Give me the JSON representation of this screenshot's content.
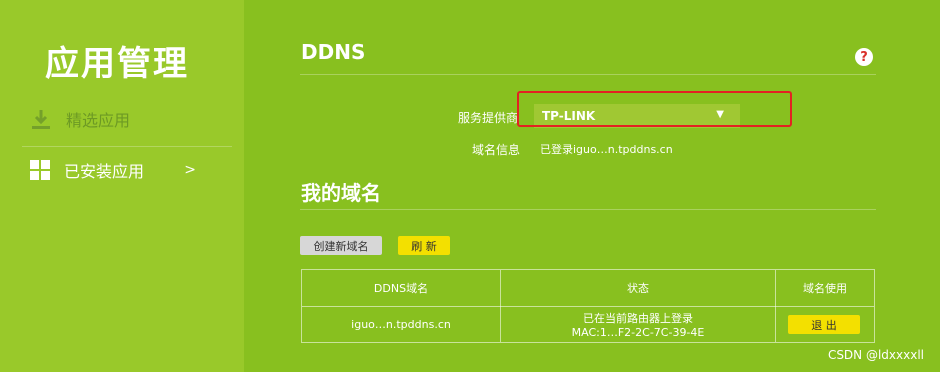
{
  "sidebar": {
    "title": "应用管理",
    "items": [
      {
        "label": "精选应用",
        "icon": "download-icon"
      },
      {
        "label": "已安装应用",
        "icon": "grid-icon",
        "chevron": ">"
      }
    ]
  },
  "main": {
    "ddns_title": "DDNS",
    "help": "?",
    "provider_label": "服务提供商",
    "provider_value": "TP-LINK",
    "domain_info_label": "域名信息",
    "domain_info_value": "已登录iguo…n.tpddns.cn",
    "my_domains_title": "我的域名",
    "create_button": "创建新域名",
    "refresh_button": "刷 新",
    "table": {
      "headers": [
        "DDNS域名",
        "状态",
        "域名使用"
      ],
      "rows": [
        {
          "domain": "iguo…n.tpddns.cn",
          "status_line1": "已在当前路由器上登录",
          "status_line2": "MAC:1…F2-2C-7C-39-4E",
          "action": "退 出"
        }
      ]
    }
  },
  "watermark": "CSDN @ldxxxxll",
  "colors": {
    "background": "#88c01f",
    "sidebar": "#99c92a",
    "accent_button": "#f3e000",
    "highlight": "#e32222"
  }
}
